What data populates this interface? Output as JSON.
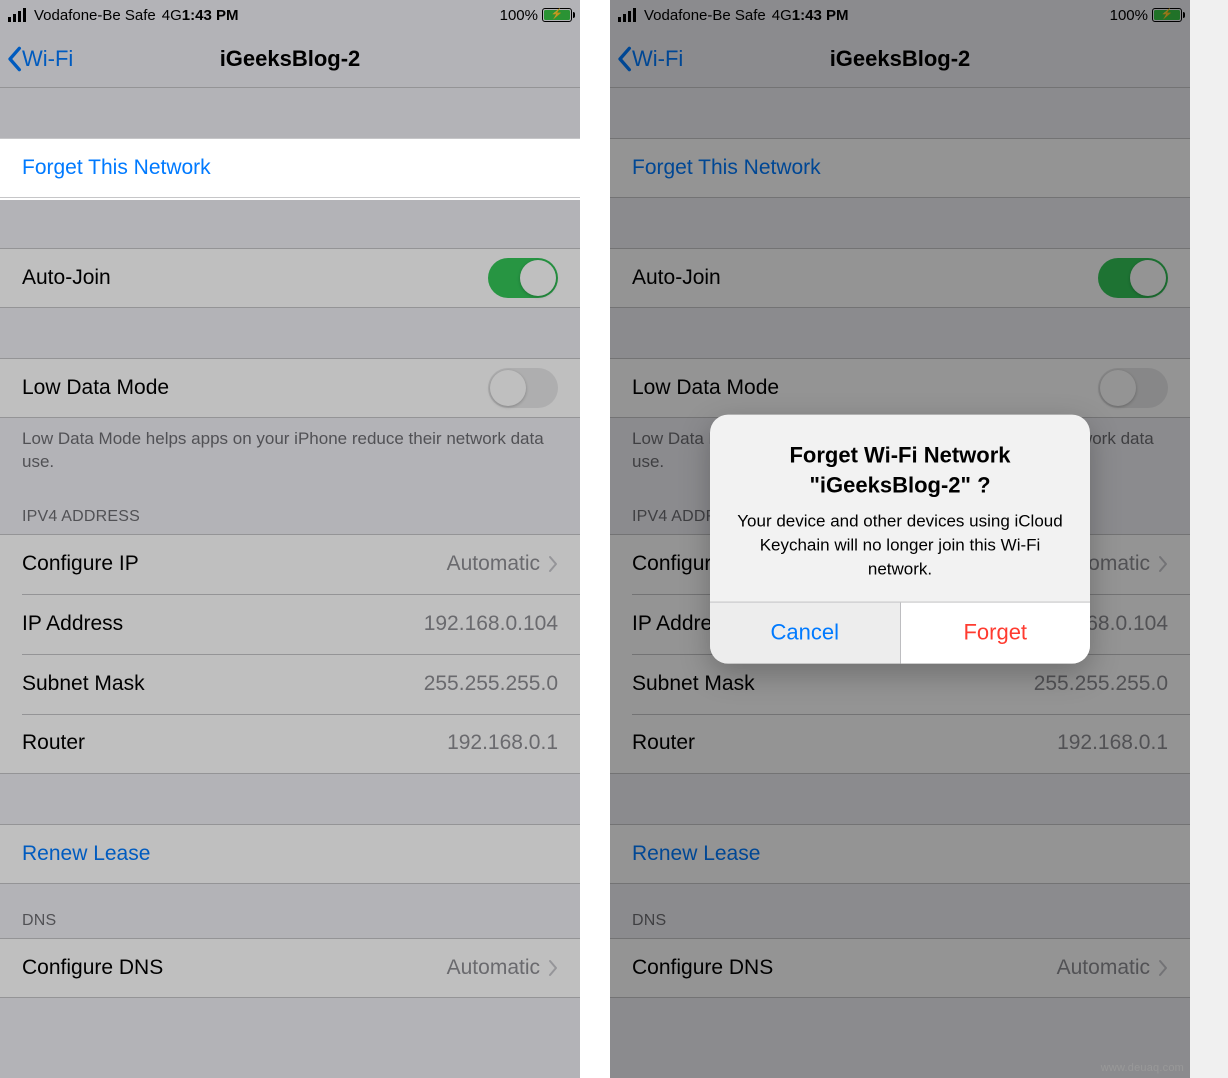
{
  "status": {
    "carrier": "Vodafone-Be Safe",
    "network": "4G",
    "time": "1:43 PM",
    "battery": "100%"
  },
  "nav": {
    "back": "Wi-Fi",
    "title": "iGeeksBlog-2"
  },
  "rows": {
    "forget": "Forget This Network",
    "autojoin": "Auto-Join",
    "lowdata": "Low Data Mode",
    "lowdata_footer": "Low Data Mode helps apps on your iPhone reduce their network data use.",
    "ipv4_header": "IPV4 ADDRESS",
    "configure_ip": "Configure IP",
    "configure_ip_value": "Automatic",
    "ip_address": "IP Address",
    "ip_address_value": "192.168.0.104",
    "subnet": "Subnet Mask",
    "subnet_value": "255.255.255.0",
    "router": "Router",
    "router_value": "192.168.0.1",
    "renew": "Renew Lease",
    "dns_header": "DNS",
    "configure_dns": "Configure DNS",
    "configure_dns_value": "Automatic"
  },
  "alert": {
    "title_line1": "Forget Wi-Fi Network",
    "title_line2": "\"iGeeksBlog-2\" ?",
    "message": "Your device and other devices using iCloud Keychain will no longer join this Wi-Fi network.",
    "cancel": "Cancel",
    "forget": "Forget"
  },
  "watermark": "www.deuaq.com"
}
